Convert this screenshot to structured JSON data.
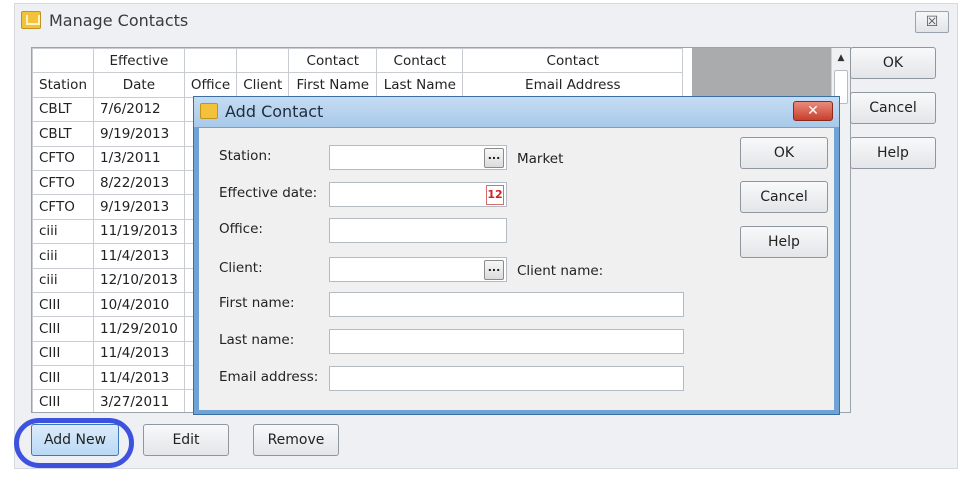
{
  "window": {
    "title": "Manage Contacts",
    "close_label": "☒"
  },
  "table": {
    "headers_top": [
      "",
      "Effective",
      "",
      "",
      "Contact",
      "Contact",
      "Contact"
    ],
    "headers_bottom": [
      "Station",
      "Date",
      "Office",
      "Client",
      "First Name",
      "Last Name",
      "Email Address"
    ],
    "rows": [
      [
        "CBLT",
        "7/6/2012"
      ],
      [
        "CBLT",
        "9/19/2013"
      ],
      [
        "CFTO",
        "1/3/2011"
      ],
      [
        "CFTO",
        "8/22/2013"
      ],
      [
        "CFTO",
        "9/19/2013"
      ],
      [
        "ciii",
        "11/19/2013"
      ],
      [
        "ciii",
        "11/4/2013"
      ],
      [
        "ciii",
        "12/10/2013"
      ],
      [
        "CIII",
        "10/4/2010"
      ],
      [
        "CIII",
        "11/29/2010"
      ],
      [
        "CIII",
        "11/4/2013"
      ],
      [
        "CIII",
        "11/4/2013"
      ],
      [
        "CIII",
        "3/27/2011"
      ]
    ]
  },
  "side_buttons": {
    "ok": "OK",
    "cancel": "Cancel",
    "help": "Help"
  },
  "bottom_buttons": {
    "add_new": "Add New",
    "edit": "Edit",
    "remove": "Remove"
  },
  "dialog": {
    "title": "Add Contact",
    "close_label": "✕",
    "labels": {
      "station": "Station:",
      "effective_date": "Effective date:",
      "office": "Office:",
      "client": "Client:",
      "first_name": "First name:",
      "last_name": "Last name:",
      "email": "Email address:",
      "market": "Market",
      "client_name": "Client name:"
    },
    "values": {
      "station": "",
      "effective_date": "",
      "office": "",
      "client": "",
      "first_name": "",
      "last_name": "",
      "email": ""
    },
    "browse_label": "...",
    "calendar_label": "12",
    "buttons": {
      "ok": "OK",
      "cancel": "Cancel",
      "help": "Help"
    }
  },
  "colors": {
    "highlight_ring": "#3d53e0",
    "dialog_frame": "#6fa3d6",
    "close_red": "#c8402d"
  }
}
